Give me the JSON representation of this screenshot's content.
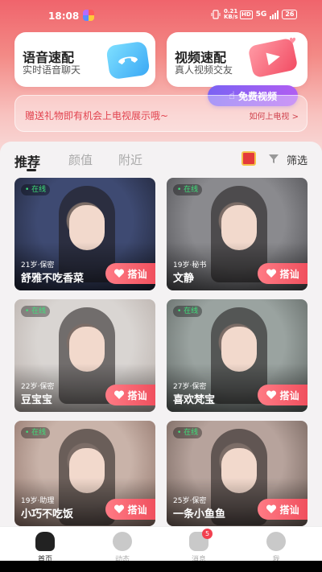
{
  "status_bar": {
    "time": "18:08",
    "net_speed_value": "0.21",
    "net_speed_unit": "KB/s",
    "hd": "HD",
    "network": "5G",
    "battery": "26"
  },
  "match_cards": {
    "voice": {
      "title": "语音速配",
      "subtitle": "实时语音聊天",
      "icon": "phone-icon"
    },
    "video": {
      "title": "视频速配",
      "subtitle": "真人视频交友",
      "icon": "play-icon"
    }
  },
  "free_video_button": {
    "label": "免费视频",
    "icon": "hand-icon"
  },
  "banner": {
    "text": "赠送礼物即有机会上电视展示哦~",
    "link": "如何上电视 >"
  },
  "tabs": [
    {
      "label": "推荐",
      "active": true
    },
    {
      "label": "颜值",
      "active": false
    },
    {
      "label": "附近",
      "active": false
    }
  ],
  "filter_label": "筛选",
  "chat_button_label": "搭讪",
  "online_label": "在线",
  "users": [
    {
      "meta": "21岁·保密",
      "name": "舒雅不吃香菜",
      "online": true,
      "photo_colors": [
        "#3e4a72",
        "#1e2233"
      ]
    },
    {
      "meta": "19岁·秘书",
      "name": "文静",
      "online": true,
      "photo_colors": [
        "#8a8a8e",
        "#4a4a4e"
      ]
    },
    {
      "meta": "22岁·保密",
      "name": "豆宝宝",
      "online": true,
      "photo_colors": [
        "#d9d5d2",
        "#b6aca7"
      ]
    },
    {
      "meta": "27岁·保密",
      "name": "喜欢梵宝",
      "online": true,
      "photo_colors": [
        "#9aa3a0",
        "#5b625f"
      ]
    },
    {
      "meta": "19岁·助理",
      "name": "小巧不吃饭",
      "online": true,
      "photo_colors": [
        "#c9b3a9",
        "#8d7066"
      ]
    },
    {
      "meta": "25岁·保密",
      "name": "一条小鱼鱼",
      "online": true,
      "photo_colors": [
        "#b7a39c",
        "#6e5d56"
      ]
    }
  ],
  "bottom_nav": [
    {
      "label": "首页",
      "icon": "home-icon",
      "active": true
    },
    {
      "label": "动态",
      "icon": "compass-icon",
      "active": false
    },
    {
      "label": "消息",
      "icon": "message-icon",
      "active": false,
      "badge": "5"
    },
    {
      "label": "我",
      "icon": "profile-icon",
      "active": false
    }
  ],
  "colors": {
    "brand_red": "#f0505e",
    "online_green": "#3ee07a",
    "header_gradient_top": "#f0646c"
  }
}
